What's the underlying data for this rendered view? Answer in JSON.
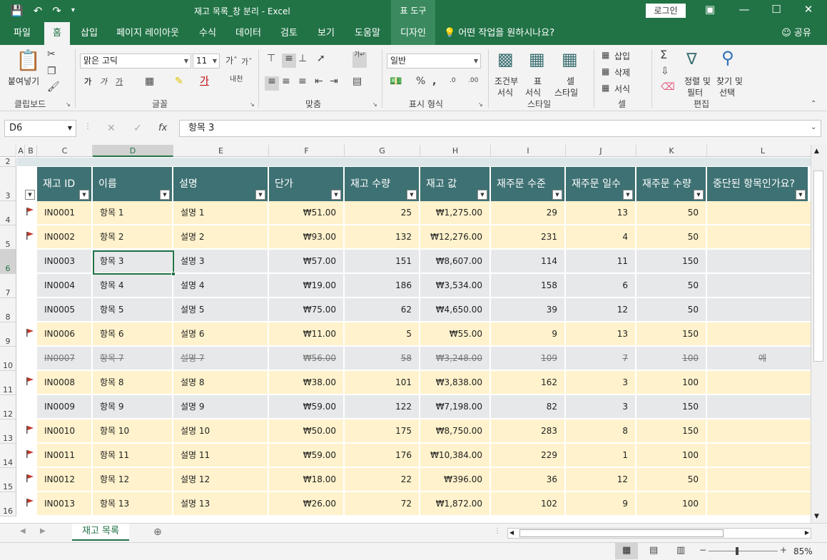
{
  "window": {
    "title": "재고 목록_창 분리  -  Excel",
    "tool_tab": "표 도구",
    "login": "로그인"
  },
  "tabs": [
    "파일",
    "홈",
    "삽입",
    "페이지 레이아웃",
    "수식",
    "데이터",
    "검토",
    "보기",
    "도움말",
    "디자인"
  ],
  "tell_me": "어떤 작업을 원하시나요?",
  "share": "공유",
  "ribbon": {
    "clipboard": {
      "paste": "붙여넣기",
      "label": "클립보드"
    },
    "font": {
      "name": "맑은 고딕",
      "size": "11",
      "label": "글꼴"
    },
    "alignment": {
      "label": "맞춤"
    },
    "number": {
      "format": "일반",
      "label": "표시 형식"
    },
    "styles": {
      "conditional": "조건부",
      "conditional2": "서식",
      "table": "표",
      "table2": "서식",
      "cell": "셀",
      "cell2": "스타일",
      "label": "스타일"
    },
    "cells": {
      "insert": "삽입",
      "delete": "삭제",
      "format": "서식",
      "label": "셀"
    },
    "editing": {
      "sort": "정렬 및",
      "sort2": "필터",
      "find": "찾기 및",
      "find2": "선택",
      "label": "편집"
    }
  },
  "formula_bar": {
    "name_box": "D6",
    "formula": "항목 3"
  },
  "columns": [
    "A",
    "B",
    "C",
    "D",
    "E",
    "F",
    "G",
    "H",
    "I",
    "J",
    "K",
    "L"
  ],
  "table": {
    "headers": [
      "재고 ID",
      "이름",
      "설명",
      "단가",
      "재고 수량",
      "재고 값",
      "재주문 수준",
      "재주문 일수",
      "재주문 수량",
      "중단된 항목인가요?"
    ],
    "rows": [
      {
        "row": "4",
        "flag": true,
        "id": "IN0001",
        "name": "항목 1",
        "desc": "설명 1",
        "price": "₩51.00",
        "qty": "25",
        "value": "₩1,275.00",
        "level": "29",
        "days": "13",
        "reorder": "50",
        "disc": ""
      },
      {
        "row": "5",
        "flag": true,
        "id": "IN0002",
        "name": "항목 2",
        "desc": "설명 2",
        "price": "₩93.00",
        "qty": "132",
        "value": "₩12,276.00",
        "level": "231",
        "days": "4",
        "reorder": "50",
        "disc": ""
      },
      {
        "row": "6",
        "flag": false,
        "id": "IN0003",
        "name": "항목 3",
        "desc": "설명 3",
        "price": "₩57.00",
        "qty": "151",
        "value": "₩8,607.00",
        "level": "114",
        "days": "11",
        "reorder": "150",
        "disc": ""
      },
      {
        "row": "7",
        "flag": false,
        "id": "IN0004",
        "name": "항목 4",
        "desc": "설명 4",
        "price": "₩19.00",
        "qty": "186",
        "value": "₩3,534.00",
        "level": "158",
        "days": "6",
        "reorder": "50",
        "disc": ""
      },
      {
        "row": "8",
        "flag": false,
        "id": "IN0005",
        "name": "항목 5",
        "desc": "설명 5",
        "price": "₩75.00",
        "qty": "62",
        "value": "₩4,650.00",
        "level": "39",
        "days": "12",
        "reorder": "50",
        "disc": ""
      },
      {
        "row": "9",
        "flag": true,
        "id": "IN0006",
        "name": "항목 6",
        "desc": "설명 6",
        "price": "₩11.00",
        "qty": "5",
        "value": "₩55.00",
        "level": "9",
        "days": "13",
        "reorder": "150",
        "disc": ""
      },
      {
        "row": "10",
        "flag": false,
        "strike": true,
        "id": "IN0007",
        "name": "항목 7",
        "desc": "설명 7",
        "price": "₩56.00",
        "qty": "58",
        "value": "₩3,248.00",
        "level": "109",
        "days": "7",
        "reorder": "100",
        "disc": "예"
      },
      {
        "row": "11",
        "flag": true,
        "id": "IN0008",
        "name": "항목 8",
        "desc": "설명 8",
        "price": "₩38.00",
        "qty": "101",
        "value": "₩3,838.00",
        "level": "162",
        "days": "3",
        "reorder": "100",
        "disc": ""
      },
      {
        "row": "12",
        "flag": false,
        "id": "IN0009",
        "name": "항목 9",
        "desc": "설명 9",
        "price": "₩59.00",
        "qty": "122",
        "value": "₩7,198.00",
        "level": "82",
        "days": "3",
        "reorder": "150",
        "disc": ""
      },
      {
        "row": "13",
        "flag": true,
        "id": "IN0010",
        "name": "항목 10",
        "desc": "설명 10",
        "price": "₩50.00",
        "qty": "175",
        "value": "₩8,750.00",
        "level": "283",
        "days": "8",
        "reorder": "150",
        "disc": ""
      },
      {
        "row": "14",
        "flag": true,
        "id": "IN0011",
        "name": "항목 11",
        "desc": "설명 11",
        "price": "₩59.00",
        "qty": "176",
        "value": "₩10,384.00",
        "level": "229",
        "days": "1",
        "reorder": "100",
        "disc": ""
      },
      {
        "row": "15",
        "flag": true,
        "id": "IN0012",
        "name": "항목 12",
        "desc": "설명 12",
        "price": "₩18.00",
        "qty": "22",
        "value": "₩396.00",
        "level": "36",
        "days": "12",
        "reorder": "50",
        "disc": ""
      },
      {
        "row": "16",
        "flag": true,
        "id": "IN0013",
        "name": "항목 13",
        "desc": "설명 13",
        "price": "₩26.00",
        "qty": "72",
        "value": "₩1,872.00",
        "level": "102",
        "days": "9",
        "reorder": "100",
        "disc": ""
      }
    ]
  },
  "sheet_tab": "재고 목록",
  "zoom": "85%",
  "colors": {
    "excel_green": "#217346",
    "table_header": "#3e7173",
    "row_yellow": "#fff2cc",
    "row_gray": "#e7e8ea",
    "flag_red": "#c0392b"
  }
}
